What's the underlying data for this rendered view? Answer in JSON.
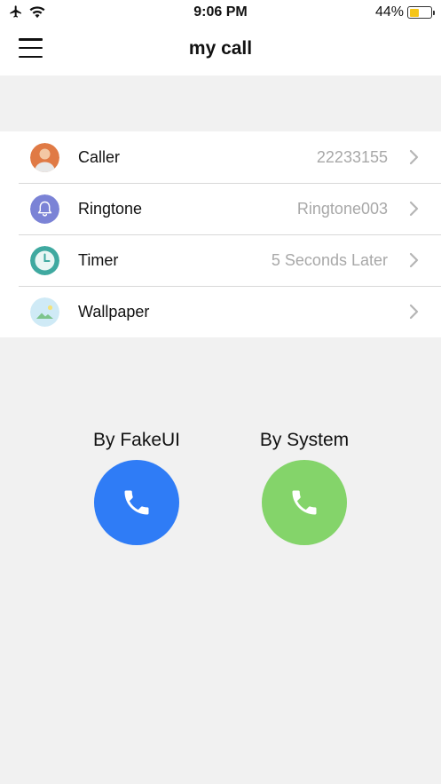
{
  "status_bar": {
    "time": "9:06 PM",
    "battery_percent": "44%",
    "battery_level": 0.44,
    "icons": [
      "airplane-icon",
      "wifi-icon",
      "battery-icon"
    ]
  },
  "nav": {
    "title": "my call",
    "menu_icon": "hamburger-menu-icon"
  },
  "settings": [
    {
      "label": "Caller",
      "value": "22233155",
      "icon": "caller-avatar-icon",
      "icon_color": "#e07a45"
    },
    {
      "label": "Ringtone",
      "value": "Ringtone003",
      "icon": "bell-icon",
      "icon_color": "#7b83d6"
    },
    {
      "label": "Timer",
      "value": "5 Seconds Later",
      "icon": "clock-icon",
      "icon_color": "#3fa9a0"
    },
    {
      "label": "Wallpaper",
      "value": "",
      "icon": "wallpaper-image-icon",
      "icon_color": "#bfe3f3"
    }
  ],
  "call_options": [
    {
      "label": "By FakeUI",
      "color": "#2f7cf6",
      "icon": "phone-icon"
    },
    {
      "label": "By System",
      "color": "#84d46a",
      "icon": "phone-icon"
    }
  ]
}
